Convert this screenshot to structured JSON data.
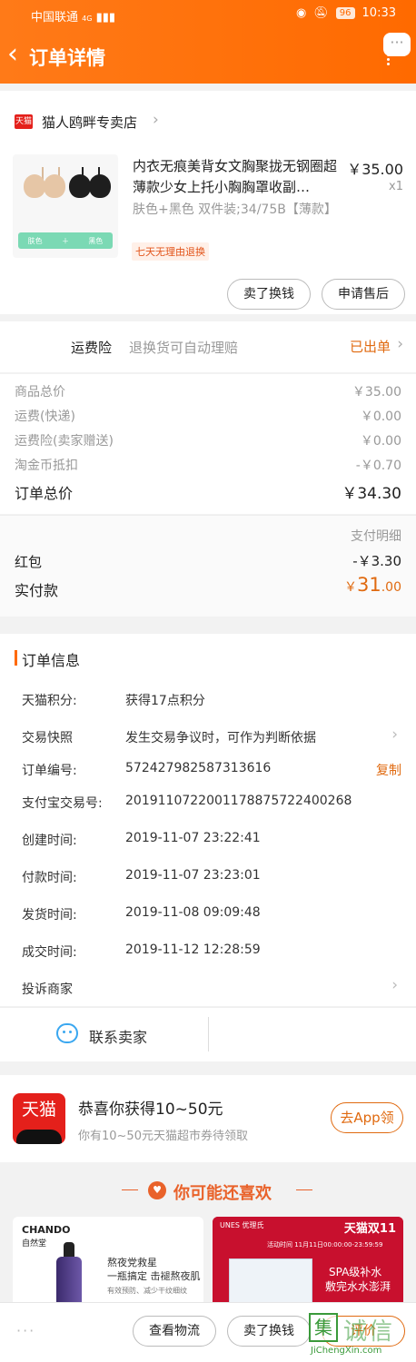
{
  "status_bar": {
    "carrier": "中国联通",
    "signal": "4G",
    "battery": "96",
    "time": "10:33"
  },
  "header": {
    "title": "订单详情",
    "more_label": "···"
  },
  "store": {
    "badge": "天猫",
    "name": "猫人鸥畔专卖店"
  },
  "product": {
    "title": "内衣无痕美背女文胸聚拢无钢圈超薄款少女上托小胸胸罩收副…",
    "price": "￥35.00",
    "qty": "x1",
    "spec": "肤色+黑色  双件装;34/75B【薄款】",
    "tag": "七天无理由退换",
    "img_labels": [
      "肤色",
      "黑色"
    ]
  },
  "actions": {
    "sell": "卖了换钱",
    "after_sale": "申请售后"
  },
  "insurance": {
    "label": "运费险",
    "desc": "退换货可自动理赔",
    "status": "已出单"
  },
  "price_rows": [
    {
      "label": "商品总价",
      "value": "￥35.00"
    },
    {
      "label": "运费(快递)",
      "value": "￥0.00"
    },
    {
      "label": "运费险(卖家赠送)",
      "value": "￥0.00"
    },
    {
      "label": "淘金币抵扣",
      "value": "-￥0.70"
    }
  ],
  "order_total": {
    "label": "订单总价",
    "value": "￥34.30"
  },
  "payment": {
    "detail": "支付明细",
    "red_packet_label": "红包",
    "red_packet_value": "-￥3.30",
    "paid_label": "实付款",
    "paid_currency": "￥",
    "paid_int": "31",
    "paid_dec": ".00"
  },
  "order_info": {
    "title": "订单信息",
    "rows": [
      {
        "label": "天猫积分:",
        "value": "获得17点积分"
      },
      {
        "label": "交易快照",
        "value": "发生交易争议时，可作为判断依据"
      },
      {
        "label": "订单编号:",
        "value": "572427982587313616"
      },
      {
        "label": "支付宝交易号:",
        "value": "2019110722001178875722400268"
      },
      {
        "label": "创建时间:",
        "value": "2019-11-07 23:22:41"
      },
      {
        "label": "付款时间:",
        "value": "2019-11-07 23:23:01"
      },
      {
        "label": "发货时间:",
        "value": "2019-11-08 09:09:48"
      },
      {
        "label": "成交时间:",
        "value": "2019-11-12 12:28:59"
      },
      {
        "label": "投诉商家",
        "value": ""
      }
    ],
    "copy": "复制"
  },
  "contact": {
    "label": "联系卖家"
  },
  "promo": {
    "logo": "天猫",
    "title": "恭喜你获得10~50元",
    "subtitle": "你有10~50元天猫超市券待领取",
    "button": "去App领"
  },
  "recommend": {
    "title": "你可能还喜欢",
    "chando": {
      "brand": "CHANDO",
      "brand_cn": "自然堂",
      "line1": "熬夜党救星",
      "line2": "一瓶搞定 击褪熬夜肌",
      "line3": "有效预防、减少干纹细纹"
    },
    "unes": {
      "brand": "UNES 优理氏",
      "badge": "天猫双11",
      "sub": "活动时间 11月11日00:00:00-23:59:59",
      "line1": "SPA级补水",
      "line2": "敷完水水澎湃"
    }
  },
  "bottom_bar": {
    "more": "···",
    "logistics": "查看物流",
    "sell": "卖了换钱",
    "review": "评价"
  },
  "watermark": {
    "char": "集",
    "text": "诚信",
    "url": "JiChengXin.com"
  },
  "colors": {
    "brand_orange": "#ff6a00",
    "accent": "#e06a10",
    "tmall_red": "#e4201b"
  }
}
